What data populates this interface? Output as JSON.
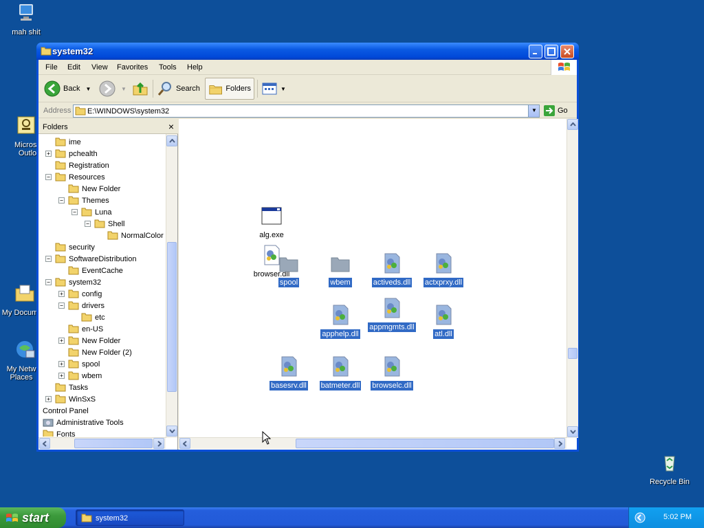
{
  "desktop": {
    "icons": [
      {
        "label": "mah shit"
      },
      {
        "label": "Microsoft Outlook",
        "visible": "Microsc Outlo"
      },
      {
        "label": "My Documents",
        "visible": "My Docum"
      },
      {
        "label": "My Network Places",
        "visible": "My Netw Places"
      },
      {
        "label": "Recycle Bin"
      }
    ]
  },
  "window": {
    "title": "system32",
    "menu": [
      "File",
      "Edit",
      "View",
      "Favorites",
      "Tools",
      "Help"
    ],
    "toolbar": {
      "back": "Back",
      "search": "Search",
      "folders": "Folders"
    },
    "address": {
      "label": "Address",
      "value": "E:\\WINDOWS\\system32",
      "go": "Go"
    }
  },
  "folders_pane": {
    "title": "Folders",
    "close": "×",
    "tree": [
      {
        "label": "ime",
        "indent": 1,
        "expander": ""
      },
      {
        "label": "pchealth",
        "indent": 1,
        "expander": "+"
      },
      {
        "label": "Registration",
        "indent": 1,
        "expander": ""
      },
      {
        "label": "Resources",
        "indent": 1,
        "expander": "−"
      },
      {
        "label": "New Folder",
        "indent": 2,
        "expander": ""
      },
      {
        "label": "Themes",
        "indent": 2,
        "expander": "−"
      },
      {
        "label": "Luna",
        "indent": 3,
        "expander": "−"
      },
      {
        "label": "Shell",
        "indent": 4,
        "expander": "−"
      },
      {
        "label": "NormalColor",
        "indent": 5,
        "expander": ""
      },
      {
        "label": "security",
        "indent": 1,
        "expander": ""
      },
      {
        "label": "SoftwareDistribution",
        "indent": 1,
        "expander": "−"
      },
      {
        "label": "EventCache",
        "indent": 2,
        "expander": ""
      },
      {
        "label": "system32",
        "indent": 1,
        "expander": "−"
      },
      {
        "label": "config",
        "indent": 2,
        "expander": "+"
      },
      {
        "label": "drivers",
        "indent": 2,
        "expander": "−"
      },
      {
        "label": "etc",
        "indent": 3,
        "expander": ""
      },
      {
        "label": "en-US",
        "indent": 2,
        "expander": ""
      },
      {
        "label": "New Folder",
        "indent": 2,
        "expander": "+"
      },
      {
        "label": "New Folder (2)",
        "indent": 2,
        "expander": ""
      },
      {
        "label": "spool",
        "indent": 2,
        "expander": "+"
      },
      {
        "label": "wbem",
        "indent": 2,
        "expander": "+"
      },
      {
        "label": "Tasks",
        "indent": 1,
        "expander": ""
      },
      {
        "label": "WinSxS",
        "indent": 1,
        "expander": "+"
      },
      {
        "label": "Control Panel",
        "indent": 0,
        "expander": "",
        "noicon": true
      },
      {
        "label": "Administrative Tools",
        "indent": 0,
        "expander": "",
        "special": true
      },
      {
        "label": "Fonts",
        "indent": 0,
        "expander": ""
      }
    ]
  },
  "content": {
    "files": [
      {
        "name": "alg.exe",
        "kind": "exe",
        "selected": false
      },
      {
        "name": "browser.dll",
        "kind": "dll",
        "selected": false
      },
      {
        "name": "spool",
        "kind": "folder",
        "selected": true
      },
      {
        "name": "wbem",
        "kind": "folder",
        "selected": true
      },
      {
        "name": "activeds.dll",
        "kind": "dll",
        "selected": true
      },
      {
        "name": "actxprxy.dll",
        "kind": "dll",
        "selected": true
      },
      {
        "name": "apphelp.dll",
        "kind": "dll",
        "selected": true
      },
      {
        "name": "appmgmts.dll",
        "kind": "dll",
        "selected": true
      },
      {
        "name": "atl.dll",
        "kind": "dll",
        "selected": true
      },
      {
        "name": "basesrv.dll",
        "kind": "dll",
        "selected": true
      },
      {
        "name": "batmeter.dll",
        "kind": "dll",
        "selected": true
      },
      {
        "name": "browselc.dll",
        "kind": "dll",
        "selected": true
      }
    ]
  },
  "taskbar": {
    "start": "start",
    "task": "system32",
    "clock": "5:02 PM"
  },
  "colors": {
    "desktop": "#0d4f9a",
    "selection": "#316ac5",
    "titlebar": "#0a5ae3",
    "taskbar": "#245edc",
    "start": "#3c9a3c"
  }
}
